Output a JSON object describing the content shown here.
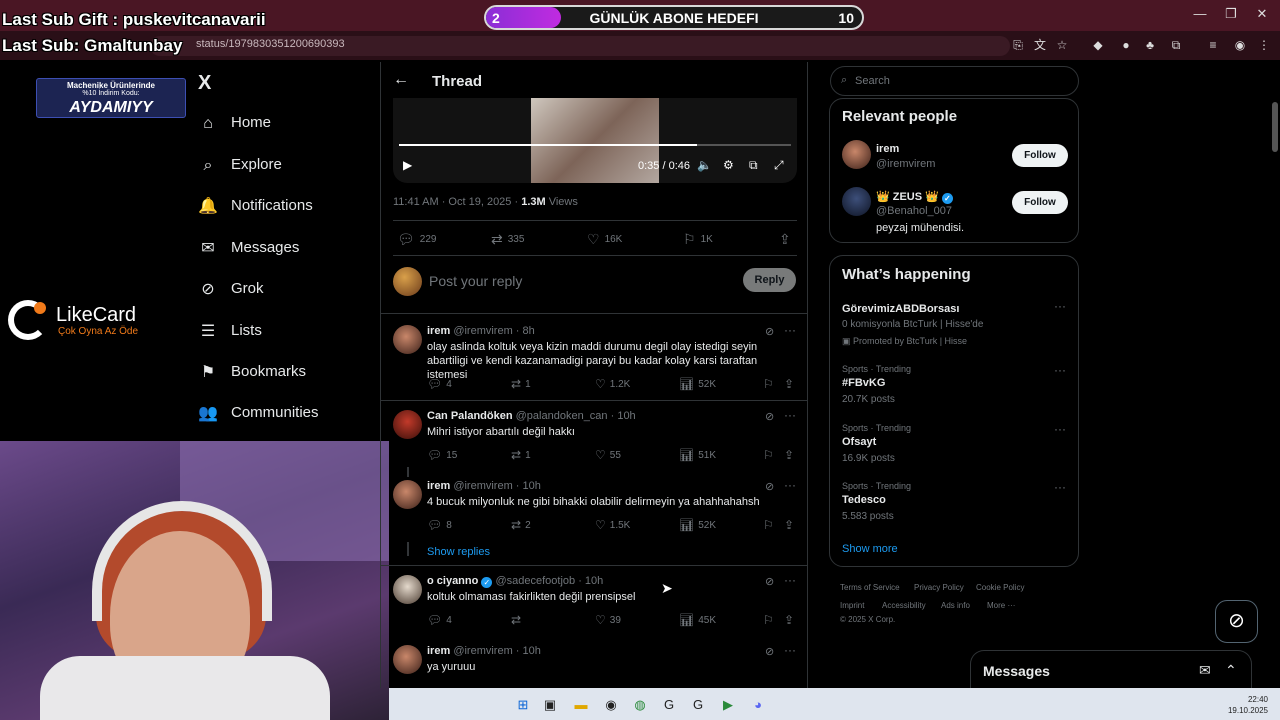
{
  "browser": {
    "url": "status/1979830351200690393",
    "tab_close": "×",
    "win_min": "—",
    "win_max": "❐",
    "win_close": "✕"
  },
  "overlay": {
    "last_sub_gift": "Last Sub Gift : puskevitcanavarii",
    "last_sub": "Last Sub: Gmaltunbay",
    "goal_current": "2",
    "goal_label": "GÜNLÜK ABONE HEDEFI",
    "goal_max": "10",
    "goal_fraction": 0.2,
    "promo_line1": "Machenike Ürünlerinde",
    "promo_line2": "%10 İndirim Kodu:",
    "promo_code": "AYDAMIYY",
    "likecard_name": "LikeCard",
    "likecard_tagline": "Çok Oyna  Az Öde"
  },
  "nav": {
    "logo": "X",
    "items": [
      {
        "label": "Home",
        "icon": "⌂"
      },
      {
        "label": "Explore",
        "icon": "⌕"
      },
      {
        "label": "Notifications",
        "icon": "🔔"
      },
      {
        "label": "Messages",
        "icon": "✉"
      },
      {
        "label": "Grok",
        "icon": "⊘"
      },
      {
        "label": "Lists",
        "icon": "☰"
      },
      {
        "label": "Bookmarks",
        "icon": "⚑"
      },
      {
        "label": "Communities",
        "icon": "👥"
      }
    ]
  },
  "thread": {
    "back": "←",
    "title": "Thread",
    "video_time": "0:35 / 0:46",
    "video_progress": 0.76,
    "meta_time": "11:41 AM · Oct 19, 2025 · ",
    "meta_views": "1.3M",
    "meta_views_label": " Views",
    "stats": {
      "replies": "229",
      "reposts": "335",
      "likes": "16K",
      "bookmarks": "1K"
    },
    "reply_placeholder": "Post your reply",
    "reply_button": "Reply",
    "show_replies": "Show replies",
    "tweets": [
      {
        "name": "irem",
        "handle": "@iremvirem · 8h",
        "text": "olay aslinda koltuk veya kizin maddi durumu degil olay istedigi seyin abartiligi ve kendi kazanamadigi parayi bu kadar kolay karsi taraftan istemesi",
        "replies": "4",
        "reposts": "1",
        "likes": "1.2K",
        "views": "52K"
      },
      {
        "name": "Can Palandöken",
        "handle": "@palandoken_can · 10h",
        "text": "Mihri istiyor abartılı değil hakkı",
        "replies": "15",
        "reposts": "1",
        "likes": "55",
        "views": "51K"
      },
      {
        "name": "irem",
        "handle": "@iremvirem · 10h",
        "text": "4 bucuk milyonluk ne gibi bihakki olabilir delirmeyin ya ahahhahahsh",
        "replies": "8",
        "reposts": "2",
        "likes": "1.5K",
        "views": "52K"
      },
      {
        "name": "o ciyanno",
        "handle": "@sadecefootjob · 10h",
        "text": "koltuk olmaması fakirlikten değil prensipsel",
        "replies": "4",
        "reposts": "",
        "likes": "39",
        "views": "45K"
      },
      {
        "name": "irem",
        "handle": "@iremvirem · 10h",
        "text": "ya yuruuu",
        "replies": "",
        "reposts": "",
        "likes": "",
        "views": ""
      }
    ]
  },
  "right": {
    "search_placeholder": "Search",
    "relevant_title": "Relevant people",
    "people": [
      {
        "name": "irem",
        "handle": "@iremvirem",
        "bio": "",
        "follow": "Follow"
      },
      {
        "name": "👑 ZEUS 👑",
        "handle": "@Benahol_007",
        "bio": "peyzaj mühendisi.",
        "follow": "Follow"
      }
    ],
    "happening_title": "What’s happening",
    "trends": [
      {
        "meta": "",
        "title": "GörevimizABDBorsası",
        "sub": "0 komisyonla BtcTurk | Hisse'de",
        "extra": "Promoted by BtcTurk | Hisse"
      },
      {
        "meta": "Sports · Trending",
        "title": "#FBvKG",
        "sub": "20.7K posts",
        "extra": ""
      },
      {
        "meta": "Sports · Trending",
        "title": "Ofsayt",
        "sub": "16.9K posts",
        "extra": ""
      },
      {
        "meta": "Sports · Trending",
        "title": "Tedesco",
        "sub": "5.583 posts",
        "extra": ""
      }
    ],
    "show_more": "Show more",
    "footer": [
      "Terms of Service",
      "Privacy Policy",
      "Cookie Policy",
      "Imprint",
      "Accessibility",
      "Ads info",
      "More ···",
      "© 2025 X Corp."
    ],
    "messages_title": "Messages"
  },
  "taskbar": {
    "time": "22:40",
    "date": "19.10.2025"
  },
  "colors": {
    "accent": "#1d9bf0",
    "chrome": "#4a1624",
    "goal_fill": "#a42ad9"
  }
}
